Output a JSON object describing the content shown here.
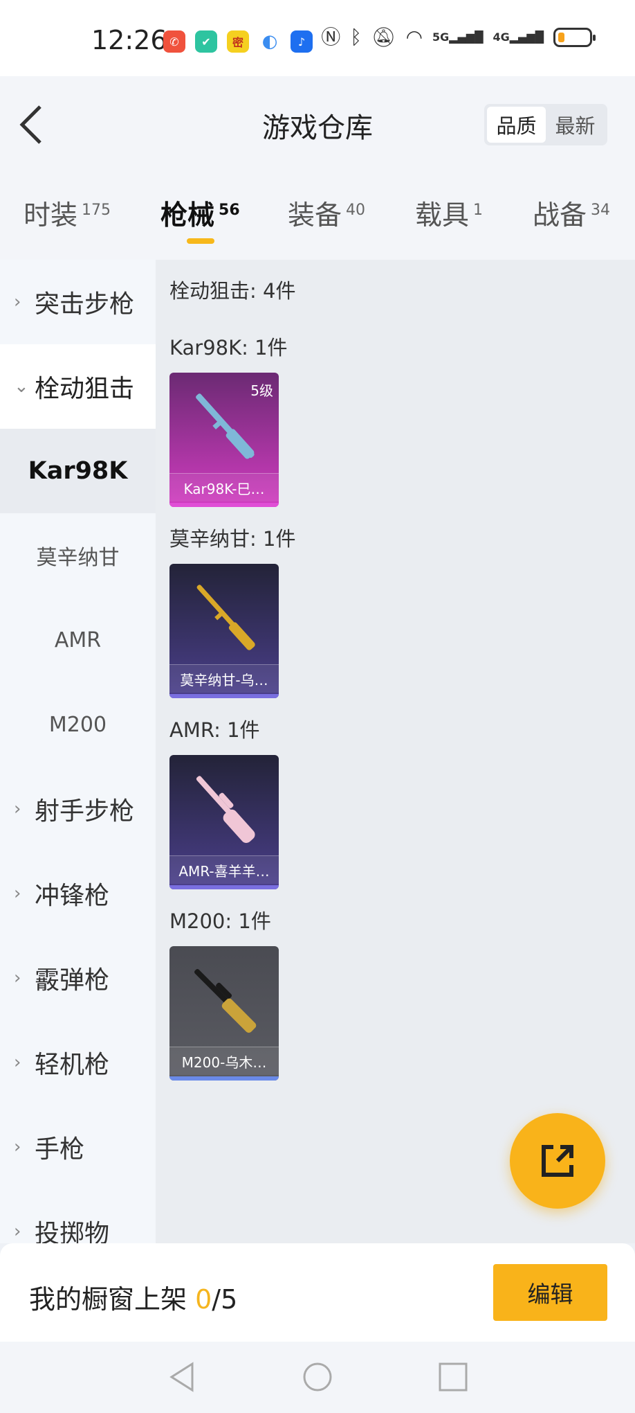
{
  "status_bar": {
    "time": "12:26",
    "app_icons": [
      {
        "name": "missed-call-icon",
        "color": "#f0523d",
        "glyph": "✆"
      },
      {
        "name": "shield-app-icon",
        "color": "#2ec4a0",
        "glyph": "✔"
      },
      {
        "name": "game-app-icon",
        "color": "#f5d020",
        "glyph": "密"
      },
      {
        "name": "browser-icon",
        "color": "#3b8df0",
        "glyph": "◐"
      },
      {
        "name": "bulb-app-icon",
        "color": "#1e6ff0",
        "glyph": "♪"
      }
    ],
    "network_labels": [
      "5G",
      "4G"
    ],
    "battery_level": 0.2
  },
  "header": {
    "title": "游戏仓库",
    "sort_options": [
      "品质",
      "最新"
    ],
    "sort_active": 0
  },
  "category_tabs": [
    {
      "label": "时装",
      "count": "175"
    },
    {
      "label": "枪械",
      "count": "56"
    },
    {
      "label": "装备",
      "count": "40"
    },
    {
      "label": "载具",
      "count": "1"
    },
    {
      "label": "战备",
      "count": "34"
    }
  ],
  "active_tab": 1,
  "sidebar": {
    "groups": [
      {
        "label": "突击步枪",
        "chevron": "›"
      },
      {
        "label": "栓动狙击",
        "chevron": "⌄"
      },
      {
        "label": "射手步枪",
        "chevron": "›"
      },
      {
        "label": "冲锋枪",
        "chevron": "›"
      },
      {
        "label": "霰弹枪",
        "chevron": "›"
      },
      {
        "label": "轻机枪",
        "chevron": "›"
      },
      {
        "label": "手枪",
        "chevron": "›"
      },
      {
        "label": "投掷物",
        "chevron": "›"
      }
    ],
    "subitems": [
      "Kar98K",
      "莫辛纳甘",
      "AMR",
      "M200"
    ],
    "active_sub": 0
  },
  "content": {
    "section_title": "栓动狙击: 4件",
    "groups": [
      {
        "heading": "Kar98K: 1件",
        "item_name": "Kar98K-巳…",
        "tier": "5级",
        "bg_top": "#6b2a73",
        "bg_bottom": "#d13cc0",
        "bar": "#e04fd6",
        "gun": "#7fb8d8"
      },
      {
        "heading": "莫辛纳甘: 1件",
        "item_name": "莫辛纳甘-乌…",
        "tier": "",
        "bg_top": "#232338",
        "bg_bottom": "#4b3f8c",
        "bar": "#7a6fe0",
        "gun": "#d9a828"
      },
      {
        "heading": "AMR: 1件",
        "item_name": "AMR-喜羊羊…",
        "tier": "",
        "bg_top": "#232338",
        "bg_bottom": "#4b3f8c",
        "bar": "#7a6fe0",
        "gun": "#f0c6d6"
      },
      {
        "heading": "M200: 1件",
        "item_name": "M200-乌木…",
        "tier": "",
        "bg_top": "#4a4b52",
        "bg_bottom": "#5b5c63",
        "bar": "#6a8ae8",
        "gun": "#caa33a"
      }
    ]
  },
  "fab": {
    "icon": "share-edit-icon"
  },
  "bottom_bar": {
    "label": "我的橱窗上架",
    "count_current": "0",
    "count_total": "/5",
    "edit_label": "编辑"
  },
  "colors": {
    "accent": "#f9b31a",
    "background": "#eef1f6"
  }
}
